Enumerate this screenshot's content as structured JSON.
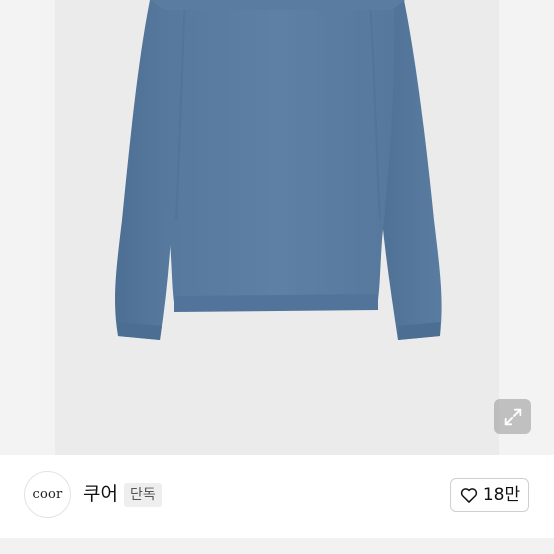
{
  "product_image": {
    "icon": "knit-sweater-photo",
    "sweater_color": "#5b7da1",
    "background_color": "#ebebeb"
  },
  "expand_button": {
    "icon": "expand-arrows-icon"
  },
  "seller": {
    "logo_text": "coor",
    "name": "쿠어",
    "badge": "단독"
  },
  "like": {
    "icon": "heart-outline-icon",
    "count": "18만"
  }
}
